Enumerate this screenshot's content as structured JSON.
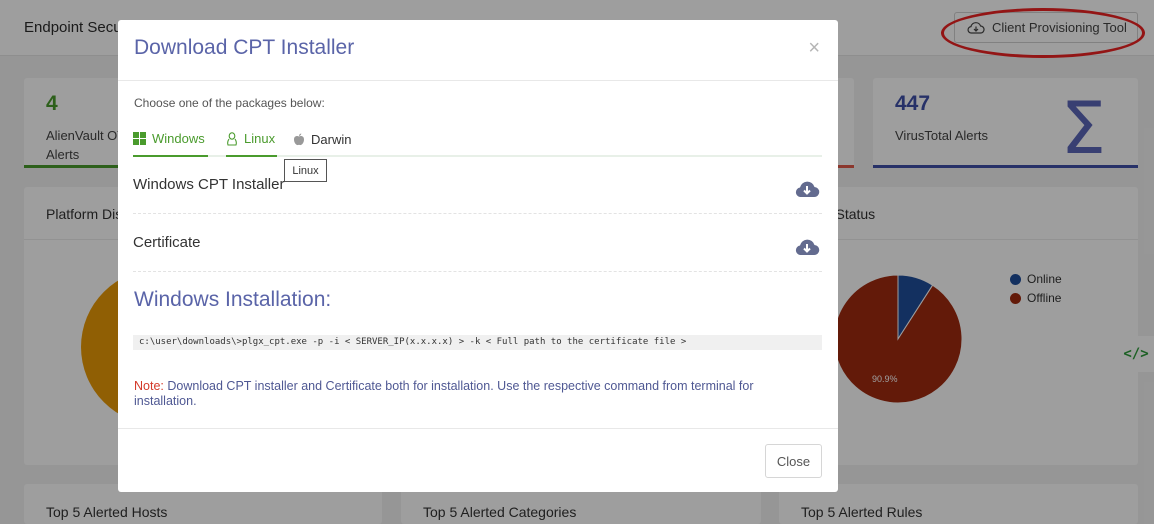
{
  "app": {
    "title": "Endpoint Security"
  },
  "header": {
    "cpt_button_label": "Client Provisioning Tool"
  },
  "stats": [
    {
      "value": "4",
      "label": "AlienVault OTX Alerts",
      "color": "#4a9b2d"
    },
    {
      "value": "",
      "label": "",
      "color": "#e15a4a"
    },
    {
      "value": "447",
      "label": "VirusTotal Alerts",
      "color": "#3f4fa8"
    }
  ],
  "panels": {
    "platform_title": "Platform Distribution",
    "status_title": "Agent Status",
    "status_legend": [
      {
        "label": "Online",
        "color": "#1f4e9c"
      },
      {
        "label": "Offline",
        "color": "#a02a10"
      }
    ],
    "status_chart_data": {
      "type": "pie",
      "slices": [
        {
          "name": "Online",
          "value": 9.1
        },
        {
          "name": "Offline",
          "value": 90.9
        }
      ],
      "label": "90.9%"
    }
  },
  "bottom_cards": [
    "Top 5 Alerted Hosts",
    "Top 5 Alerted Categories",
    "Top 5 Alerted Rules"
  ],
  "modal": {
    "title": "Download CPT Installer",
    "close_x": "×",
    "prompt": "Choose one of the packages below:",
    "tabs": [
      {
        "label": "Windows",
        "icon": "windows-icon",
        "active": true
      },
      {
        "label": "Linux",
        "icon": "linux-icon",
        "active": true
      },
      {
        "label": "Darwin",
        "icon": "apple-icon",
        "active": false
      }
    ],
    "tooltip": "Linux",
    "downloads": [
      {
        "label": "Windows CPT Installer",
        "icon": "cloud-download-icon"
      },
      {
        "label": "Certificate",
        "icon": "cloud-download-icon"
      }
    ],
    "install_title": "Windows Installation:",
    "command": "c:\\user\\downloads\\>plgx_cpt.exe -p -i < SERVER_IP(x.x.x.x) > -k < Full path to the certificate file >",
    "note_label": "Note:",
    "note_text": " Download CPT installer and Certificate both for installation. Use the respective command from terminal for installation.",
    "close_button": "Close"
  }
}
